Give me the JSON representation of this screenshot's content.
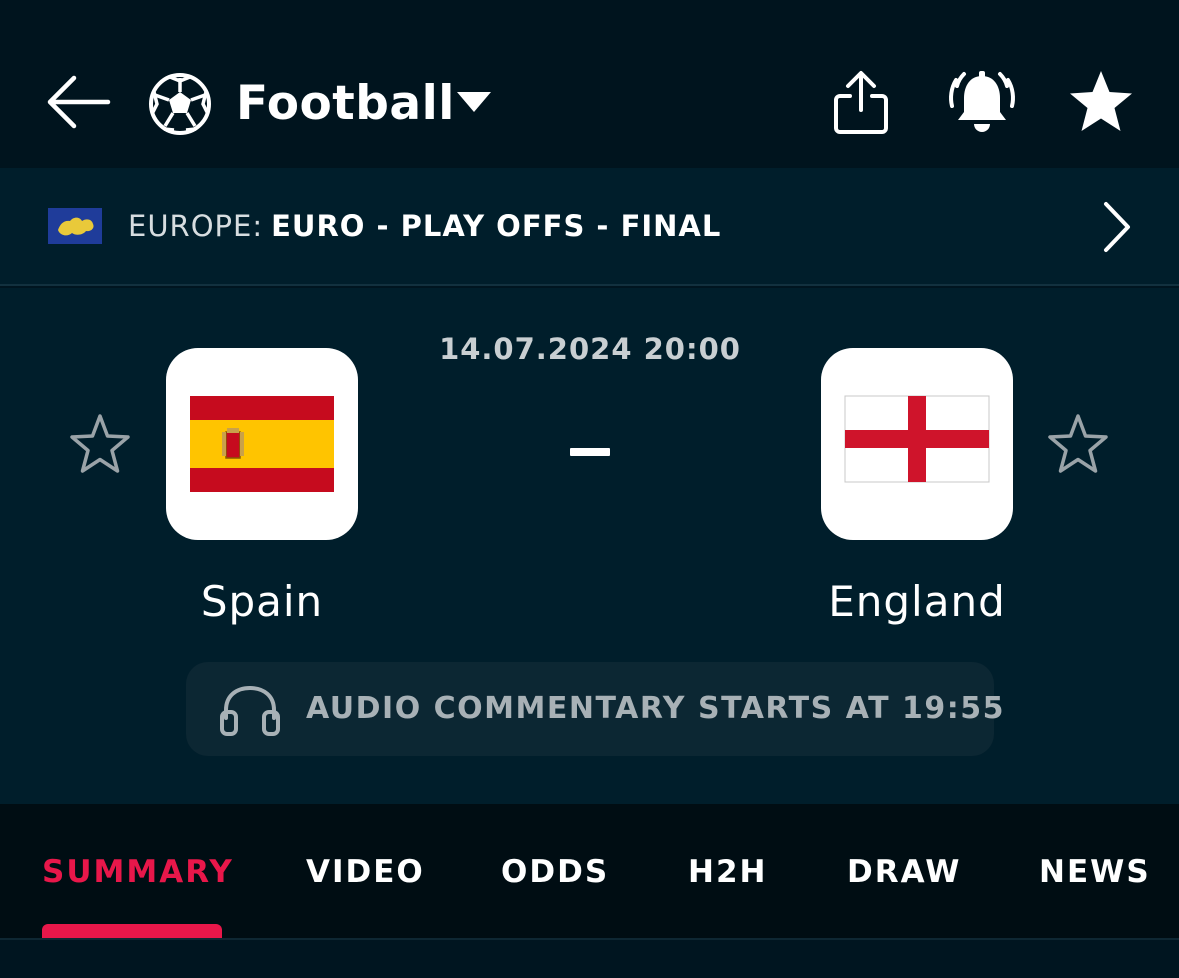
{
  "header": {
    "sport_title": "Football",
    "icons": [
      "back-arrow-icon",
      "football-icon",
      "caret-down-icon",
      "share-icon",
      "bell-alarm-icon",
      "star-icon"
    ]
  },
  "league": {
    "country": "EUROPE:",
    "name": "EURO - PLAY OFFS - FINAL",
    "flag": "europe-flag"
  },
  "match": {
    "datetime": "14.07.2024 20:00",
    "score": "-",
    "home_team": {
      "name": "Spain",
      "flag": "spain-flag"
    },
    "away_team": {
      "name": "England",
      "flag": "england-flag"
    },
    "audio_commentary": "AUDIO COMMENTARY STARTS AT 19:55"
  },
  "tabs": [
    {
      "label": "SUMMARY",
      "active": true
    },
    {
      "label": "VIDEO",
      "active": false
    },
    {
      "label": "ODDS",
      "active": false
    },
    {
      "label": "H2H",
      "active": false
    },
    {
      "label": "DRAW",
      "active": false
    },
    {
      "label": "NEWS",
      "active": false
    }
  ],
  "colors": {
    "background": "#001520",
    "panel": "#001e2b",
    "accent": "#e8174a",
    "muted_text": "#a8b1b6"
  }
}
